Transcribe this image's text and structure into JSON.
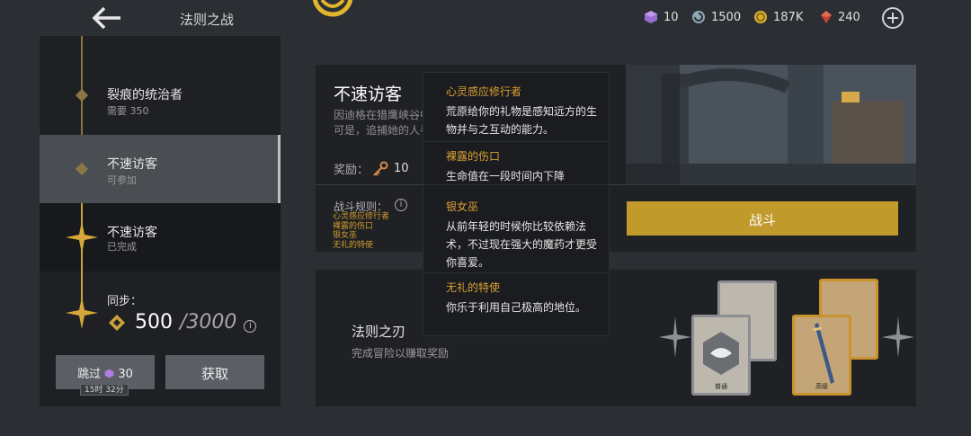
{
  "header": {
    "title": "法则之战",
    "resources": [
      {
        "icon": "purple-cube-icon",
        "value": "10"
      },
      {
        "icon": "spiral-token-icon",
        "value": "1500"
      },
      {
        "icon": "gold-coin-icon",
        "value": "187K"
      },
      {
        "icon": "red-gem-icon",
        "value": "240"
      }
    ]
  },
  "stages": [
    {
      "name": "裂痕的统治者",
      "sub": "需要 350",
      "state": "locked"
    },
    {
      "name": "不速访客",
      "sub": "可参加",
      "state": "active"
    },
    {
      "name": "不速访客",
      "sub": "已完成",
      "state": "completed"
    }
  ],
  "sync": {
    "label": "同步：",
    "current": "500",
    "max": "/3000"
  },
  "buttons": {
    "skip_label": "跳过",
    "skip_cost": "30",
    "skip_timer": "15时 32分",
    "get_label": "获取",
    "fight_label": "战斗"
  },
  "quest": {
    "name": "不速访客",
    "desc_line1": "因迪格在猎鹰峡谷中，",
    "desc_line2": "可是，追捕她的人手不",
    "reward_label": "奖励：",
    "reward_amount": "10",
    "rules_label": "战斗规则：",
    "rules": [
      "心灵感应修行者",
      "裸露的伤口",
      "银女巫",
      "无礼的特使"
    ]
  },
  "tooltip": [
    {
      "title": "心灵感应修行者",
      "body": "荒原给你的礼物是感知远方的生物并与之互动的能力。"
    },
    {
      "title": "裸露的伤口",
      "body": "生命值在一段时间内下降"
    },
    {
      "title": "银女巫",
      "body": "从前年轻的时候你比较依赖法术，不过现在强大的魔药才更受你喜爱。"
    },
    {
      "title": "无礼的特使",
      "body": "你乐于利用自己极高的地位。"
    }
  ],
  "blade": {
    "name": "法则之刃",
    "sub": "完成冒险以赚取奖励",
    "card_grey_label": "普通",
    "card_gold_label": "高级"
  },
  "colors": {
    "accent_gold": "#c19a2c",
    "rule_orange": "#d19a2c",
    "panel": "#1f2125",
    "background": "#2b2e33"
  }
}
